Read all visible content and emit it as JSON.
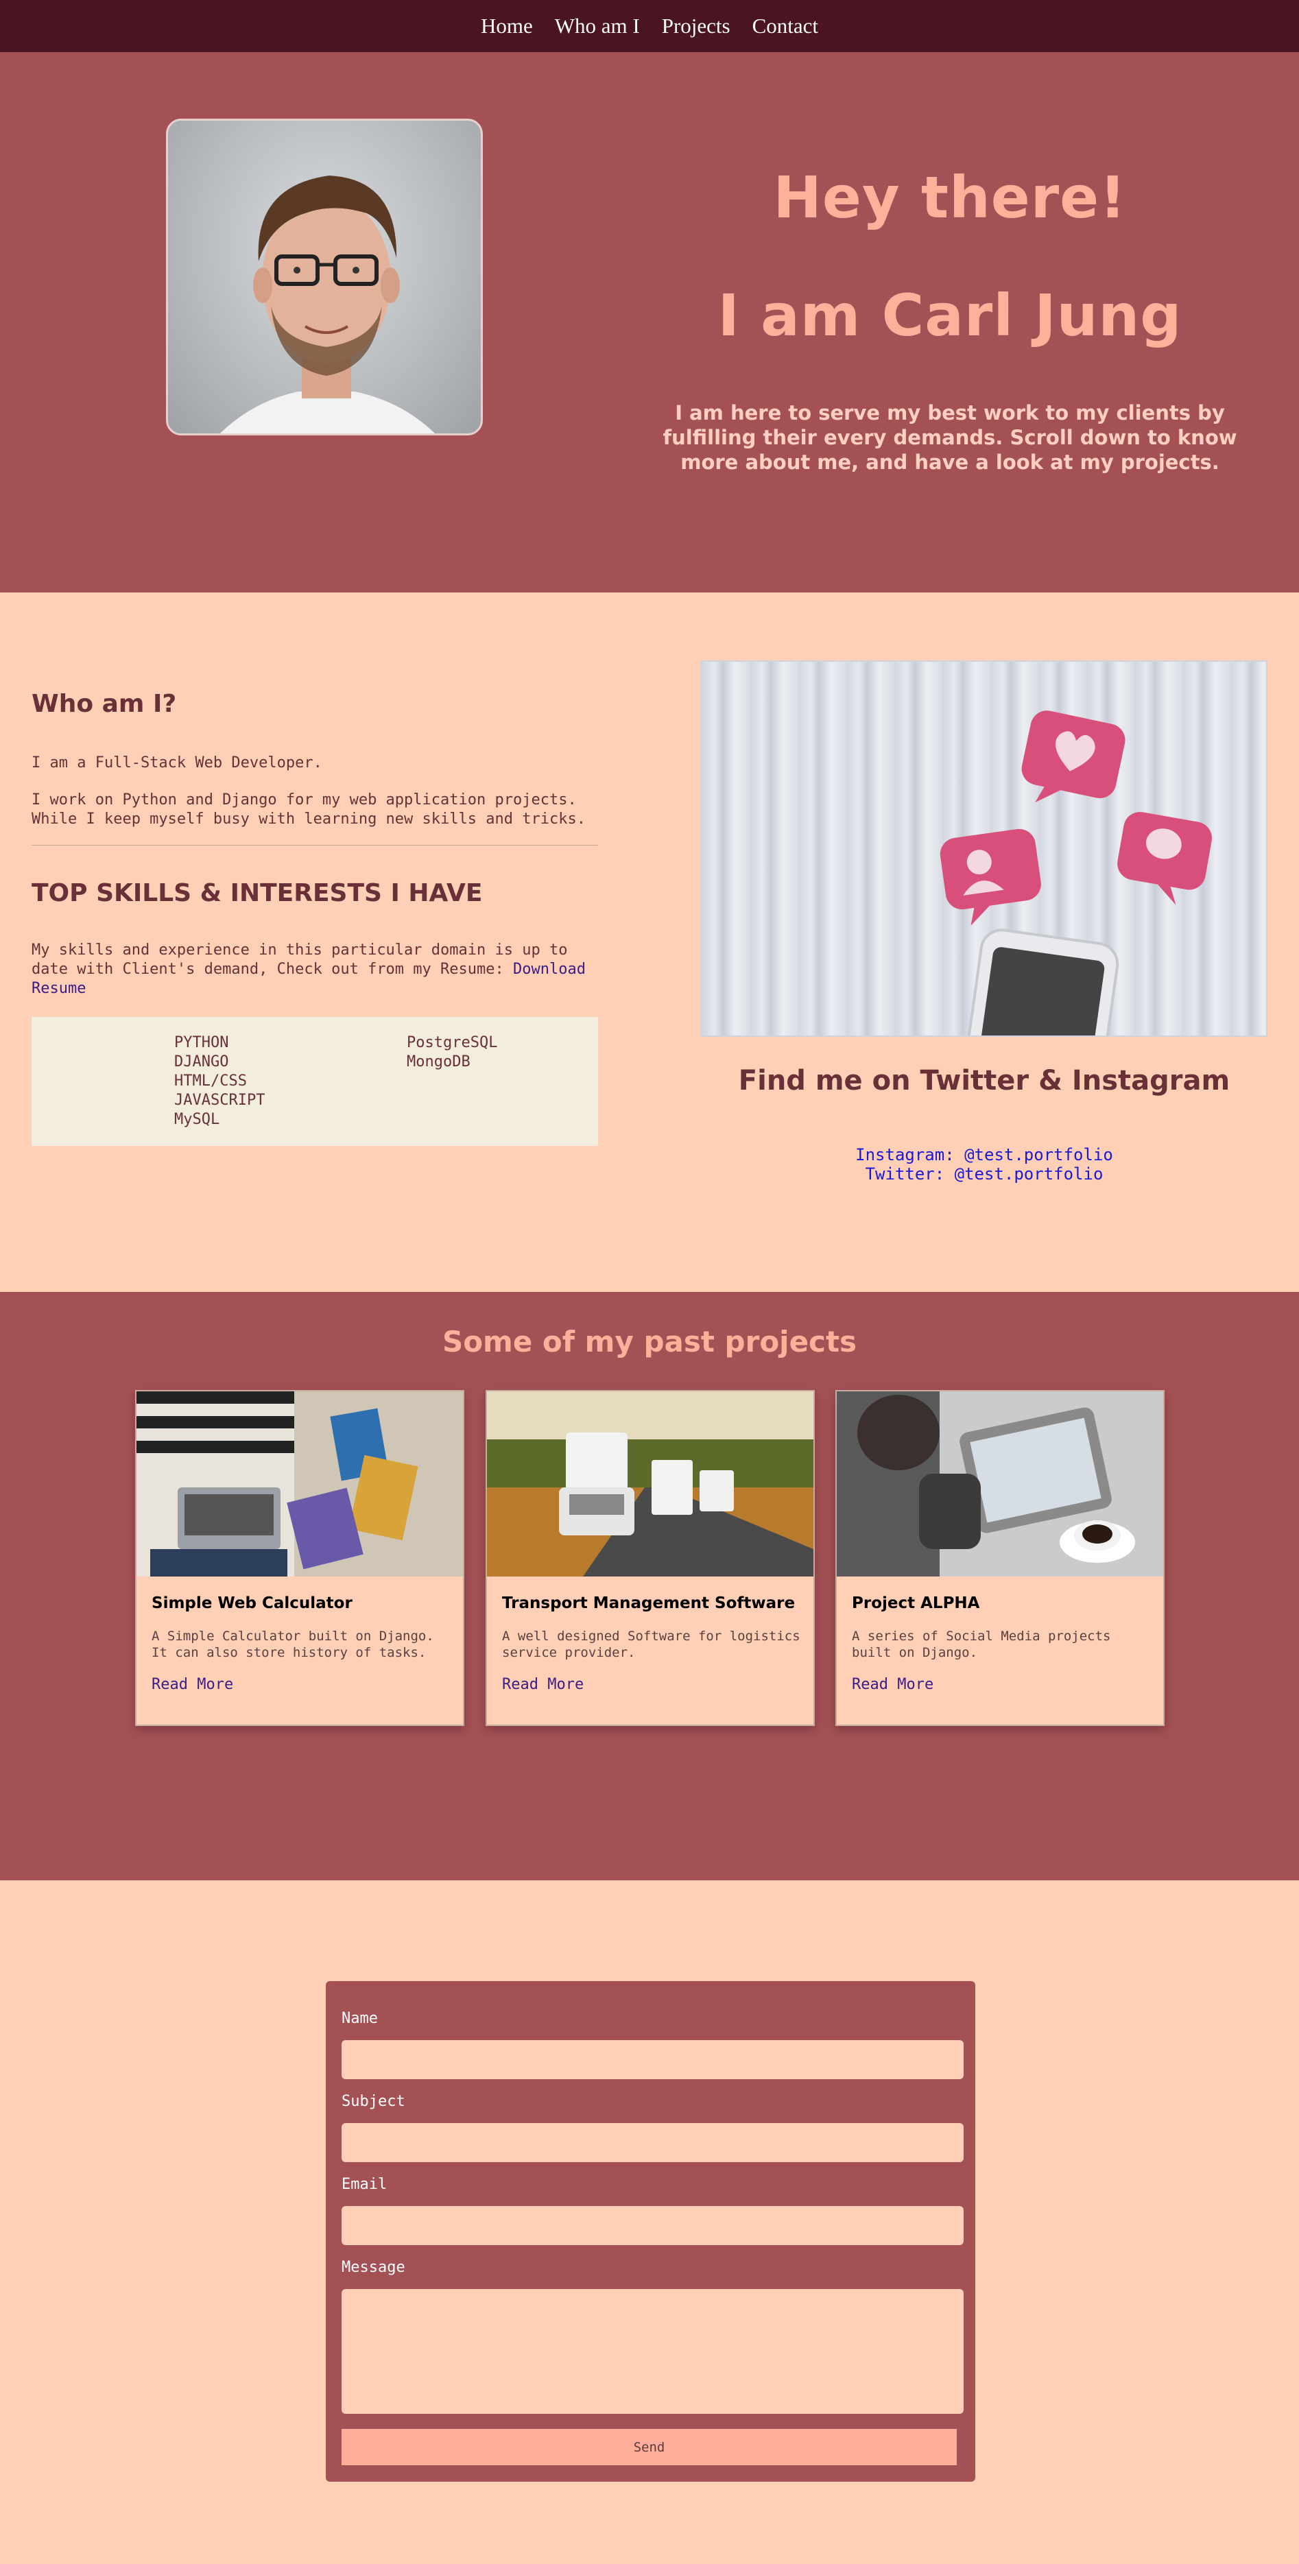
{
  "nav": {
    "items": [
      "Home",
      "Who am I",
      "Projects",
      "Contact"
    ]
  },
  "hero": {
    "greeting": "Hey there!",
    "name": "I am Carl Jung",
    "description": "I am here to serve my best work to my clients by fulfilling their every demands. Scroll down to know more about me, and have a look at my projects."
  },
  "about": {
    "heading": "Who am I?",
    "line1": "I am a Full-Stack Web Developer.",
    "line2": "I work on Python and Django for my web application projects. While I keep myself busy with learning new skills and tricks."
  },
  "skills": {
    "heading": "TOP SKILLS & INTERESTS I HAVE",
    "text": "My skills and experience in this particular domain is up to date with Client's demand, Check out from my Resume: ",
    "resume_link": "Download Resume",
    "col1": [
      "PYTHON",
      "DJANGO",
      "HTML/CSS",
      "JAVASCRIPT",
      "MySQL"
    ],
    "col2": [
      "PostgreSQL",
      "MongoDB"
    ]
  },
  "social": {
    "heading": "Find me on Twitter & Instagram",
    "instagram": "Instagram: @test.portfolio",
    "twitter": "Twitter: @test.portfolio"
  },
  "projects": {
    "heading": "Some of my past projects",
    "items": [
      {
        "title": "Simple Web Calculator",
        "desc": "A Simple Calculator built on Django. It can also store history of tasks.",
        "link": "Read More"
      },
      {
        "title": "Transport Management Software",
        "desc": "A well designed Software for logistics service provider.",
        "link": "Read More"
      },
      {
        "title": "Project ALPHA",
        "desc": "A series of Social Media projects built on Django.",
        "link": "Read More"
      }
    ]
  },
  "contact": {
    "name_label": "Name",
    "subject_label": "Subject",
    "email_label": "Email",
    "message_label": "Message",
    "send_label": "Send"
  },
  "colors": {
    "nav_bg": "#4a1521",
    "section_bg": "#a45155",
    "page_bg": "#ffcfb6",
    "accent_text": "#ffb09a"
  }
}
